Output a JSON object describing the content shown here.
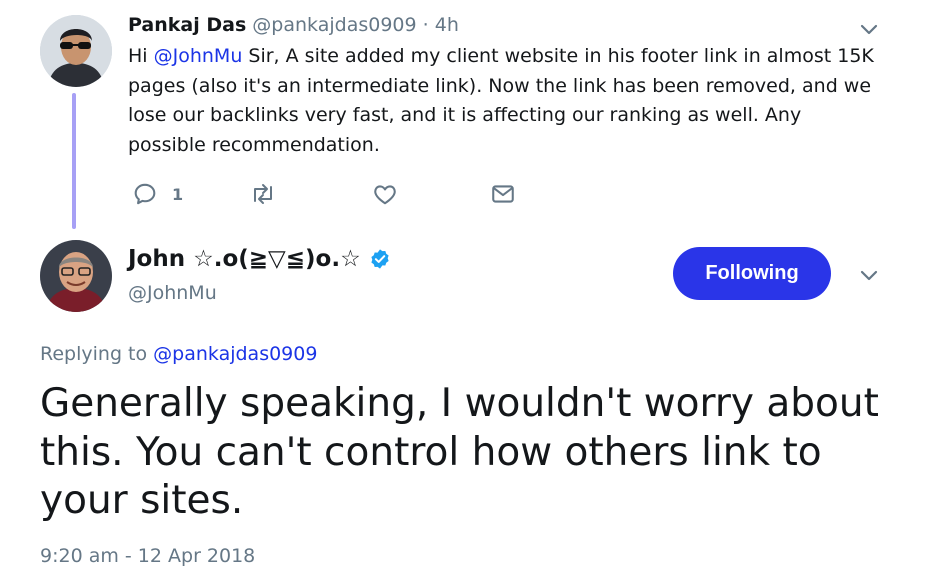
{
  "parent_tweet": {
    "author_name": "Pankaj Das",
    "author_handle": "@pankajdas0909",
    "separator": "·",
    "time": "4h",
    "text_prefix": "Hi ",
    "mention": "@JohnMu",
    "text_body": " Sir, A site added my client website in his footer link in almost 15K pages (also it's an intermediate link). Now the link has been removed, and we lose our backlinks very fast, and it is affecting our ranking as well. Any possible recommendation.",
    "reply_count": "1",
    "icons": [
      "reply-icon",
      "retweet-icon",
      "like-icon",
      "direct-message-icon",
      "chevron-down-icon"
    ]
  },
  "main_tweet": {
    "author_name": "John ☆.o(≧▽≦)o.☆",
    "author_handle": "@JohnMu",
    "verified": true,
    "follow_label": "Following",
    "replying_label": "Replying to ",
    "replying_handle": "@pankajdas0909",
    "text": "Generally speaking, I wouldn't worry about this. You can't control how others link to your sites.",
    "timestamp": "9:20 am - 12 Apr 2018"
  },
  "colors": {
    "accent": "#2a35e8",
    "link": "#1b34e6",
    "muted": "#657786",
    "text": "#14171a",
    "thread_line": "#a7a0f5",
    "verified": "#1da1f2"
  }
}
